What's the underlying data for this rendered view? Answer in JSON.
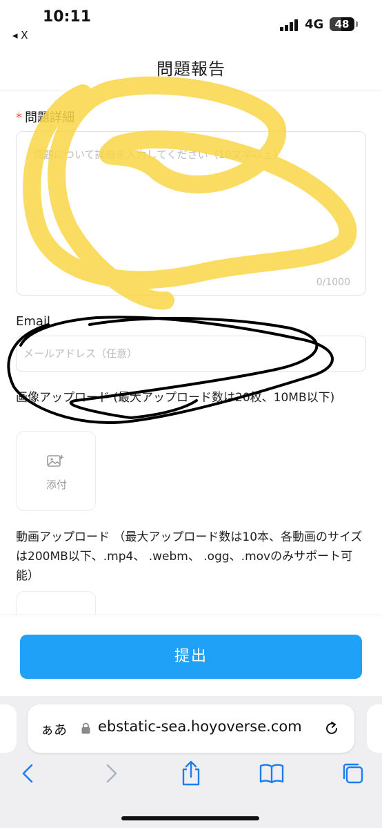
{
  "status_bar": {
    "time": "10:11",
    "back_app": "◂ X",
    "network": "4G",
    "battery": "48",
    "battery_level_percent": 48
  },
  "page": {
    "title": "問題報告"
  },
  "form": {
    "detail": {
      "required_mark": "*",
      "label": "問題詳細",
      "placeholder": "問題について詳細を入力してください（10文字以上）",
      "counter": "0/1000"
    },
    "email": {
      "label": "Email",
      "placeholder": "メールアドレス（任意）"
    },
    "image_upload": {
      "label": "画像アップロード (最大アップロード数は20枚、10MB以下)",
      "attach_label": "添付"
    },
    "video_upload": {
      "label": "動画アップロード （最大アップロード数は10本、各動画のサイズは200MB以下、.mp4、 .webm、 .ogg、.movのみサポート可能）"
    },
    "submit_label": "提出"
  },
  "browser": {
    "aa_label": "ぁあ",
    "url": "ebstatic-sea.hoyoverse.com",
    "accent_color": "#1e7cf2"
  },
  "annotations": {
    "yellow_color": "#f9d648",
    "black_color": "#000000"
  }
}
